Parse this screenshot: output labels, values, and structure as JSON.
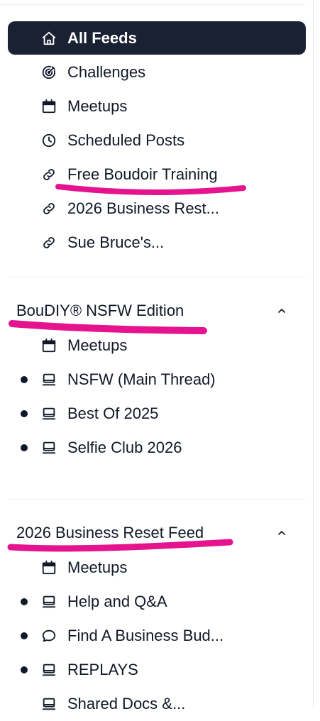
{
  "top_nav": {
    "items": [
      {
        "label": "All Feeds",
        "icon": "home-icon",
        "active": true
      },
      {
        "label": "Challenges",
        "icon": "target-icon"
      },
      {
        "label": "Meetups",
        "icon": "calendar-icon"
      },
      {
        "label": "Scheduled Posts",
        "icon": "clock-icon"
      },
      {
        "label": "Free Boudoir Training",
        "icon": "link-icon"
      },
      {
        "label": "2026 Business Rest...",
        "icon": "link-icon"
      },
      {
        "label": "Sue Bruce's...",
        "icon": "link-icon"
      }
    ]
  },
  "sections": [
    {
      "title": "BouDIY® NSFW Edition",
      "expanded": true,
      "items": [
        {
          "label": "Meetups",
          "icon": "calendar-icon",
          "unread": false
        },
        {
          "label": "NSFW (Main Thread)",
          "icon": "monitor-icon",
          "unread": true
        },
        {
          "label": "Best Of 2025",
          "icon": "monitor-icon",
          "unread": true
        },
        {
          "label": "Selfie Club 2026",
          "icon": "monitor-icon",
          "unread": true
        }
      ]
    },
    {
      "title": "2026 Business Reset Feed",
      "expanded": true,
      "items": [
        {
          "label": "Meetups",
          "icon": "calendar-icon",
          "unread": false
        },
        {
          "label": "Help and Q&A",
          "icon": "monitor-icon",
          "unread": true
        },
        {
          "label": "Find A Business Bud...",
          "icon": "chat-bubble-icon",
          "unread": true
        },
        {
          "label": "REPLAYS",
          "icon": "monitor-icon",
          "unread": true
        },
        {
          "label": "Shared Docs &...",
          "icon": "monitor-icon",
          "unread": false
        }
      ]
    }
  ],
  "colors": {
    "active_bg": "#1a2133",
    "text": "#111827",
    "highlighter": "#e6138f",
    "divider": "#f0f0f3"
  }
}
